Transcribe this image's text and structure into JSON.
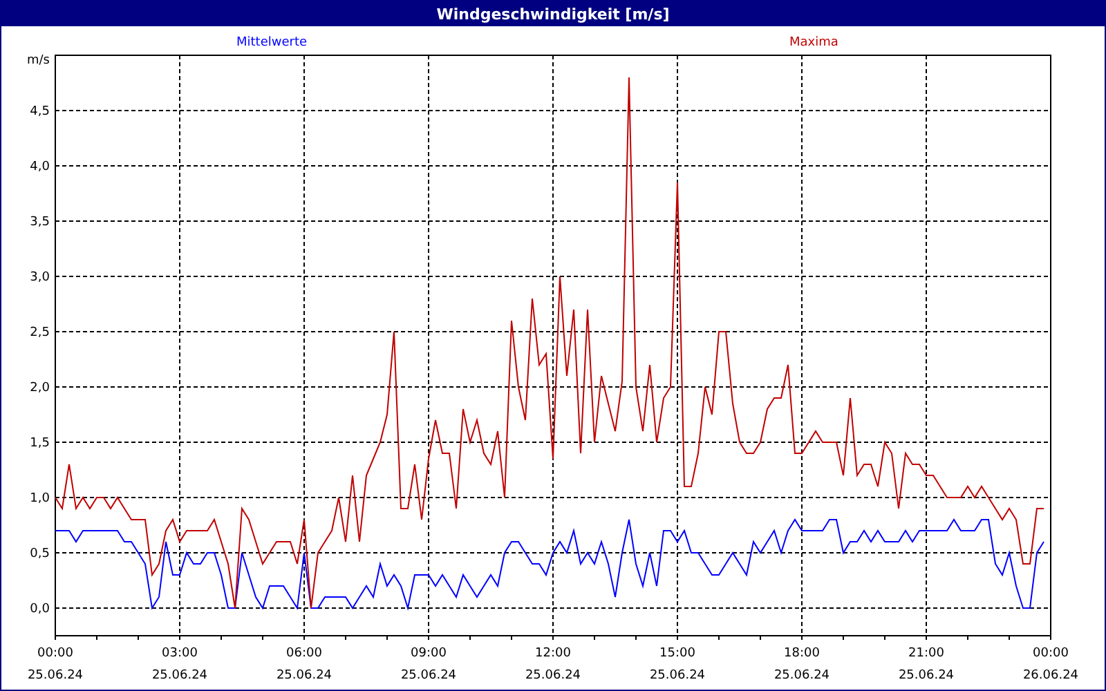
{
  "window": {
    "title": "Windgeschwindigkeit [m/s]"
  },
  "chart": {
    "chart_data": {
      "type": "line",
      "ylabel": "m/s",
      "categories": [
        "00:00\n25.06.24",
        null,
        null,
        null,
        null,
        null,
        null,
        null,
        null,
        null,
        null,
        null,
        null,
        null,
        null,
        null,
        null,
        null,
        "03:00\n25.06.24",
        null,
        null,
        null,
        null,
        null,
        null,
        null,
        null,
        null,
        null,
        null,
        null,
        null,
        null,
        null,
        null,
        null,
        "06:00\n25.06.24",
        null,
        null,
        null,
        null,
        null,
        null,
        null,
        null,
        null,
        null,
        null,
        null,
        null,
        null,
        null,
        null,
        null,
        "09:00\n25.06.24",
        null,
        null,
        null,
        null,
        null,
        null,
        null,
        null,
        null,
        null,
        null,
        null,
        null,
        null,
        null,
        null,
        null,
        "12:00\n25.06.24",
        null,
        null,
        null,
        null,
        null,
        null,
        null,
        null,
        null,
        null,
        null,
        null,
        null,
        null,
        null,
        null,
        null,
        "15:00\n25.06.24",
        null,
        null,
        null,
        null,
        null,
        null,
        null,
        null,
        null,
        null,
        null,
        null,
        null,
        null,
        null,
        null,
        null,
        "18:00\n25.06.24",
        null,
        null,
        null,
        null,
        null,
        null,
        null,
        null,
        null,
        null,
        null,
        null,
        null,
        null,
        null,
        null,
        null,
        "21:00\n25.06.24",
        null,
        null,
        null,
        null,
        null,
        null,
        null,
        null,
        null,
        null,
        null,
        null,
        null,
        null,
        null,
        null,
        null,
        "00:00\n26.06.24"
      ],
      "series": [
        {
          "name": "Mittelwerte",
          "color": "#0000ff",
          "values": [
            0.7,
            0.7,
            0.7,
            0.6,
            0.7,
            0.7,
            0.7,
            0.7,
            0.7,
            0.7,
            0.6,
            0.6,
            0.5,
            0.4,
            0.0,
            0.1,
            0.6,
            0.3,
            0.3,
            0.5,
            0.4,
            0.4,
            0.5,
            0.5,
            0.3,
            0.0,
            0.0,
            0.5,
            0.3,
            0.1,
            0.0,
            0.2,
            0.2,
            0.2,
            0.1,
            0.0,
            0.5,
            0.0,
            0.0,
            0.1,
            0.1,
            0.1,
            0.1,
            0.0,
            0.1,
            0.2,
            0.1,
            0.4,
            0.2,
            0.3,
            0.2,
            0.0,
            0.3,
            0.3,
            0.3,
            0.2,
            0.3,
            0.2,
            0.1,
            0.3,
            0.2,
            0.1,
            0.2,
            0.3,
            0.2,
            0.5,
            0.6,
            0.6,
            0.5,
            0.4,
            0.4,
            0.3,
            0.5,
            0.6,
            0.5,
            0.7,
            0.4,
            0.5,
            0.4,
            0.6,
            0.4,
            0.1,
            0.5,
            0.8,
            0.4,
            0.2,
            0.5,
            0.2,
            0.7,
            0.7,
            0.6,
            0.7,
            0.5,
            0.5,
            0.4,
            0.3,
            0.3,
            0.4,
            0.5,
            0.4,
            0.3,
            0.6,
            0.5,
            0.6,
            0.7,
            0.5,
            0.7,
            0.8,
            0.7,
            0.7,
            0.7,
            0.7,
            0.8,
            0.8,
            0.5,
            0.6,
            0.6,
            0.7,
            0.6,
            0.7,
            0.6,
            0.6,
            0.6,
            0.7,
            0.6,
            0.7,
            0.7,
            0.7,
            0.7,
            0.7,
            0.8,
            0.7,
            0.7,
            0.7,
            0.8,
            0.8,
            0.4,
            0.3,
            0.5,
            0.2,
            0.0,
            0.0,
            0.5,
            0.6,
            null
          ]
        },
        {
          "name": "Maxima",
          "color": "#c00000",
          "values": [
            1.0,
            0.9,
            1.3,
            0.9,
            1.0,
            0.9,
            1.0,
            1.0,
            0.9,
            1.0,
            0.9,
            0.8,
            0.8,
            0.8,
            0.3,
            0.4,
            0.7,
            0.8,
            0.6,
            0.7,
            0.7,
            0.7,
            0.7,
            0.8,
            0.6,
            0.4,
            0.0,
            0.9,
            0.8,
            0.6,
            0.4,
            0.5,
            0.6,
            0.6,
            0.6,
            0.4,
            0.8,
            0.0,
            0.5,
            0.6,
            0.7,
            1.0,
            0.6,
            1.2,
            0.6,
            1.2,
            1.35,
            1.5,
            1.75,
            2.5,
            0.9,
            0.9,
            1.3,
            0.8,
            1.35,
            1.7,
            1.4,
            1.4,
            0.9,
            1.8,
            1.5,
            1.7,
            1.4,
            1.3,
            1.6,
            1.0,
            2.6,
            2.0,
            1.7,
            2.8,
            2.2,
            2.3,
            1.35,
            3.0,
            2.1,
            2.7,
            1.4,
            2.7,
            1.5,
            2.1,
            1.85,
            1.6,
            2.05,
            4.8,
            2.0,
            1.6,
            2.2,
            1.5,
            1.9,
            2.0,
            3.85,
            1.1,
            1.1,
            1.4,
            2.0,
            1.75,
            2.5,
            2.5,
            1.85,
            1.5,
            1.4,
            1.4,
            1.5,
            1.8,
            1.9,
            1.9,
            2.2,
            1.4,
            1.4,
            1.5,
            1.6,
            1.5,
            1.5,
            1.5,
            1.2,
            1.9,
            1.2,
            1.3,
            1.3,
            1.1,
            1.5,
            1.4,
            0.9,
            1.4,
            1.3,
            1.3,
            1.2,
            1.2,
            1.1,
            1.0,
            1.0,
            1.0,
            1.1,
            1.0,
            1.1,
            1.0,
            0.9,
            0.8,
            0.9,
            0.8,
            0.4,
            0.4,
            0.9,
            0.9,
            null
          ]
        }
      ],
      "ylim": [
        -0.25,
        5.0
      ],
      "grid": true,
      "yticks": [
        {
          "value": 0,
          "label": "0,0"
        },
        {
          "value": 0.5,
          "label": "0,5"
        },
        {
          "value": 1,
          "label": "1,0"
        },
        {
          "value": 1.5,
          "label": "1,5"
        },
        {
          "value": 2,
          "label": "2,0"
        },
        {
          "value": 2.5,
          "label": "2,5"
        },
        {
          "value": 3,
          "label": "3,0"
        },
        {
          "value": 3.5,
          "label": "3,5"
        },
        {
          "value": 4,
          "label": "4,0"
        },
        {
          "value": 4.5,
          "label": "4,5"
        }
      ]
    }
  }
}
